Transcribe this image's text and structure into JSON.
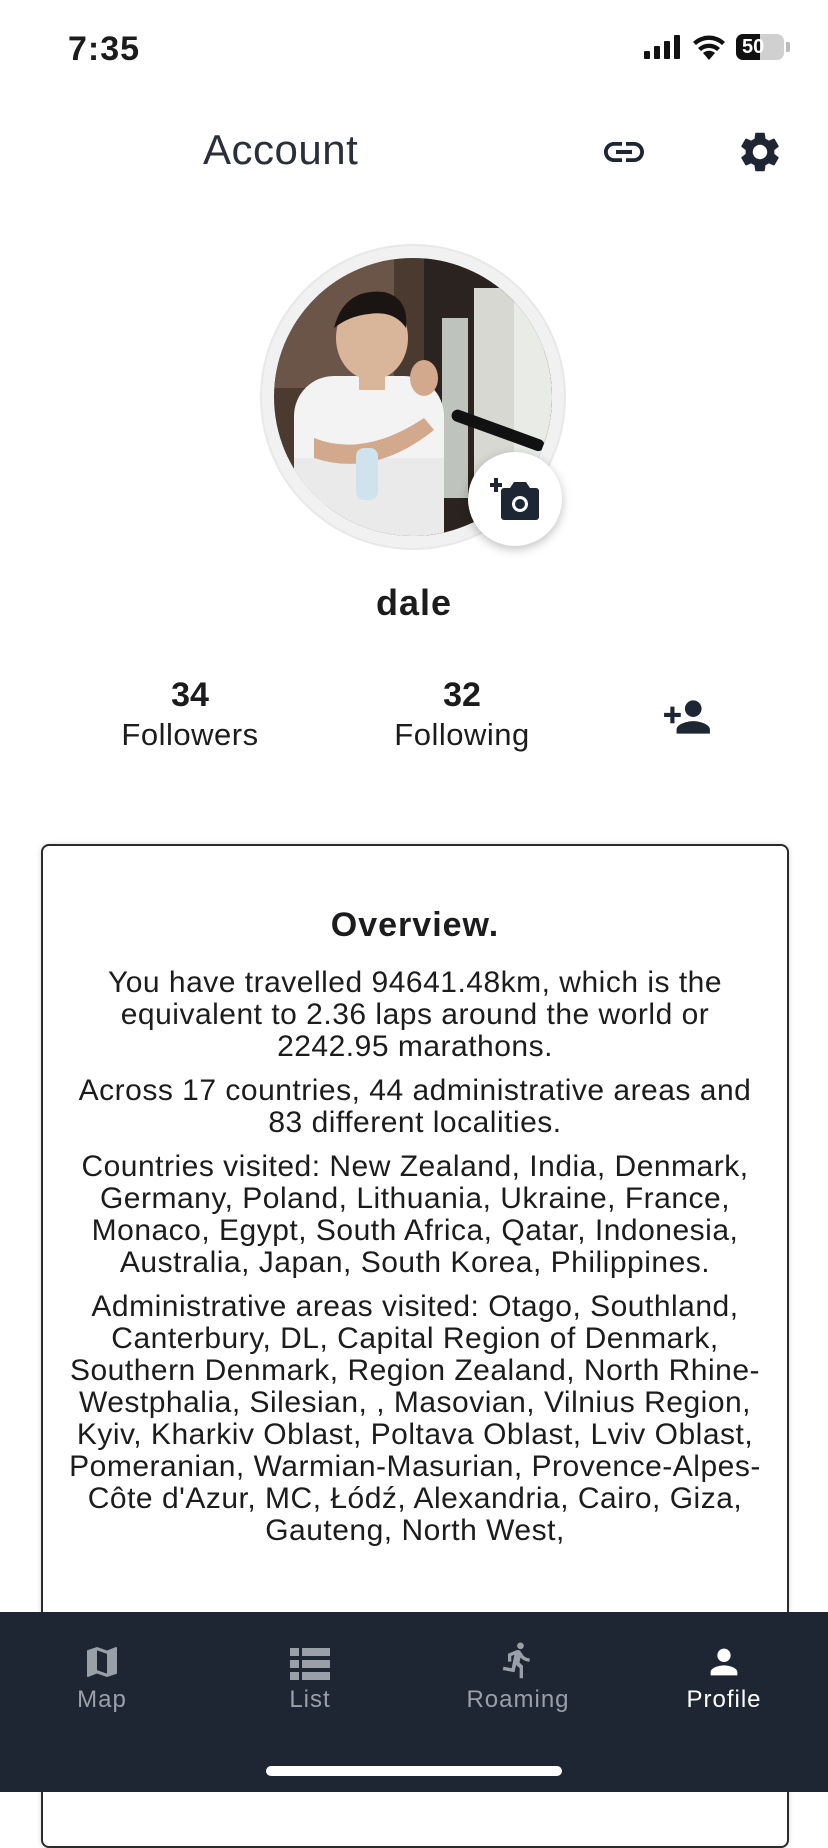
{
  "status": {
    "time": "7:35",
    "battery": "50"
  },
  "header": {
    "title": "Account"
  },
  "profile": {
    "username": "dale"
  },
  "stats": {
    "followers_count": "34",
    "followers_label": "Followers",
    "following_count": "32",
    "following_label": "Following"
  },
  "overview": {
    "title": "Overview.",
    "paragraphs": [
      "You have travelled 94641.48km, which is the equivalent to 2.36 laps around the world or 2242.95 marathons.",
      "Across 17 countries, 44 administrative areas and 83 different localities.",
      "Countries visited: New Zealand, India, Denmark, Germany, Poland, Lithuania, Ukraine, France, Monaco, Egypt, South Africa, Qatar, Indonesia, Australia, Japan, South Korea, Philippines.",
      "Administrative areas visited: Otago, Southland, Canterbury, DL, Capital Region of Denmark, Southern Denmark, Region Zealand, North Rhine-Westphalia, Silesian, , Masovian, Vilnius Region, Kyiv, Kharkiv Oblast, Poltava Oblast, Lviv Oblast, Pomeranian, Warmian-Masurian, Provence-Alpes-Côte d'Azur, MC, Łódź, Alexandria, Cairo, Giza, Gauteng, North West,"
    ]
  },
  "nav": {
    "items": [
      {
        "label": "Map",
        "icon": "map-icon"
      },
      {
        "label": "List",
        "icon": "list-icon"
      },
      {
        "label": "Roaming",
        "icon": "walking-icon"
      },
      {
        "label": "Profile",
        "icon": "person-icon"
      }
    ],
    "active": "Profile"
  },
  "colors": {
    "nav_bg": "#1e2633",
    "nav_inactive": "#9aa0a8",
    "text": "#1c1c1e"
  }
}
